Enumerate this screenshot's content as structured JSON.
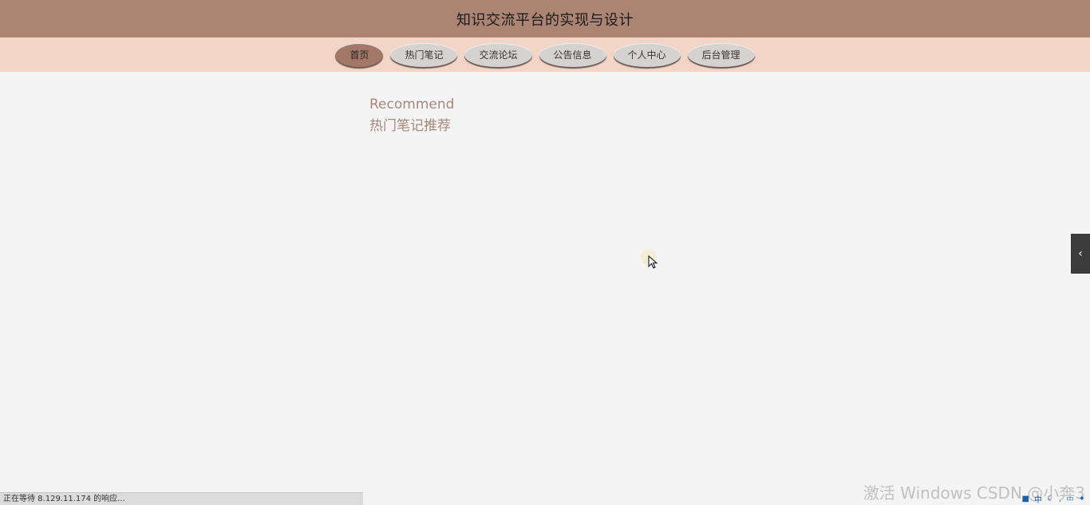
{
  "header": {
    "title": "知识交流平台的实现与设计"
  },
  "nav": {
    "items": [
      {
        "label": "首页",
        "active": true
      },
      {
        "label": "热门笔记",
        "active": false
      },
      {
        "label": "交流论坛",
        "active": false
      },
      {
        "label": "公告信息",
        "active": false
      },
      {
        "label": "个人中心",
        "active": false
      },
      {
        "label": "后台管理",
        "active": false
      }
    ]
  },
  "recommend": {
    "en": "Recommend",
    "zh": "热门笔记推荐"
  },
  "side_tab": {
    "icon": "chevron-left-icon",
    "glyph": "‹"
  },
  "statusbar": {
    "text": "正在等待 8.129.11.174 的响应..."
  },
  "watermark": {
    "text": "激活 Windows CSDN @小奔3"
  },
  "colors": {
    "header_bg": "#ac8474",
    "nav_bg": "#f3d5c7",
    "nav_active": "#a47868",
    "nav_inactive": "#d5d3d1",
    "accent_text": "#a5877a"
  }
}
